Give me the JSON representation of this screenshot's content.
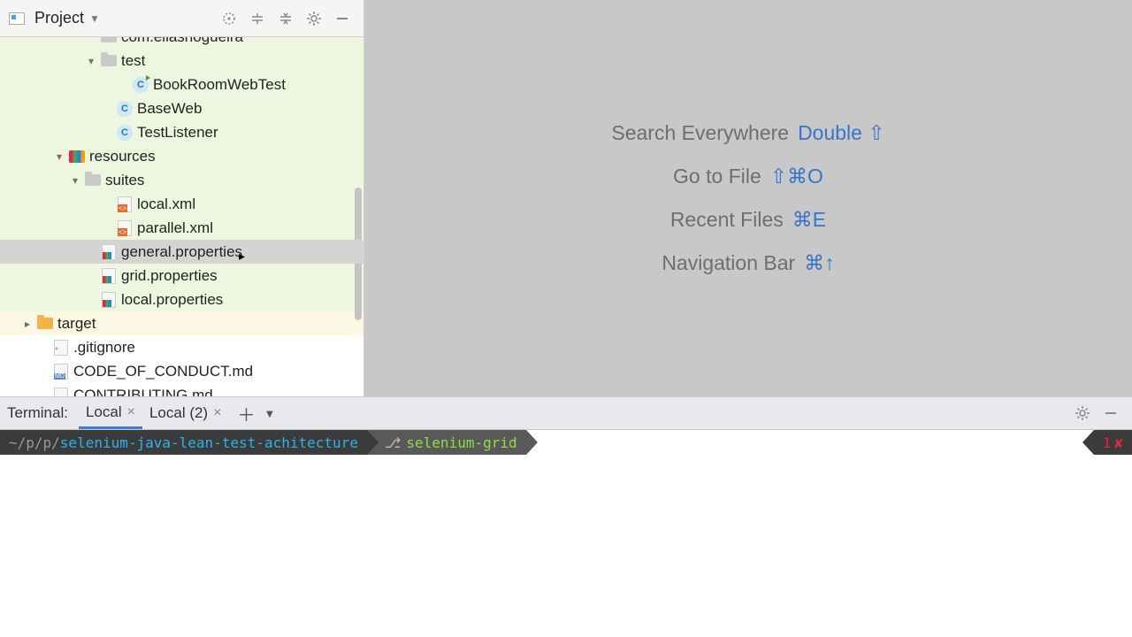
{
  "header": {
    "title": "Project"
  },
  "tree": {
    "items": [
      {
        "indent": 5,
        "arrow": "",
        "icon": "folder",
        "label": "com.eliasnogueira",
        "row": "hl-green cut"
      },
      {
        "indent": 5,
        "arrow": "down",
        "icon": "folder",
        "label": "test",
        "row": "hl-green"
      },
      {
        "indent": 7,
        "arrow": "",
        "icon": "class-run",
        "label": "BookRoomWebTest",
        "row": "hl-green"
      },
      {
        "indent": 6,
        "arrow": "",
        "icon": "class",
        "label": "BaseWeb",
        "row": "hl-green"
      },
      {
        "indent": 6,
        "arrow": "",
        "icon": "class",
        "label": "TestListener",
        "row": "hl-green"
      },
      {
        "indent": 3,
        "arrow": "down",
        "icon": "res",
        "label": "resources",
        "row": "hl-green"
      },
      {
        "indent": 4,
        "arrow": "down",
        "icon": "folder",
        "label": "suites",
        "row": "hl-green"
      },
      {
        "indent": 6,
        "arrow": "",
        "icon": "xml",
        "label": "local.xml",
        "row": "hl-green"
      },
      {
        "indent": 6,
        "arrow": "",
        "icon": "xml",
        "label": "parallel.xml",
        "row": "hl-green"
      },
      {
        "indent": 5,
        "arrow": "",
        "icon": "prop",
        "label": "general.properties",
        "row": "selected"
      },
      {
        "indent": 5,
        "arrow": "",
        "icon": "prop",
        "label": "grid.properties",
        "row": "hl-green"
      },
      {
        "indent": 5,
        "arrow": "",
        "icon": "prop",
        "label": "local.properties",
        "row": "hl-green"
      },
      {
        "indent": 1,
        "arrow": "right",
        "icon": "folder-orange",
        "label": "target",
        "row": "hl-yellow"
      },
      {
        "indent": 2,
        "arrow": "",
        "icon": "git",
        "label": ".gitignore",
        "row": ""
      },
      {
        "indent": 2,
        "arrow": "",
        "icon": "md",
        "label": "CODE_OF_CONDUCT.md",
        "row": ""
      },
      {
        "indent": 2,
        "arrow": "",
        "icon": "md",
        "label": "CONTRIBUTING.md",
        "row": ""
      }
    ]
  },
  "tips": [
    {
      "label": "Search Everywhere",
      "shortcut": "Double ⇧"
    },
    {
      "label": "Go to File",
      "shortcut": "⇧⌘O"
    },
    {
      "label": "Recent Files",
      "shortcut": "⌘E"
    },
    {
      "label": "Navigation Bar",
      "shortcut": "⌘↑"
    }
  ],
  "terminal": {
    "label": "Terminal:",
    "tabs": [
      {
        "name": "Local",
        "active": true
      },
      {
        "name": "Local (2)",
        "active": false
      }
    ],
    "prompt": {
      "path_prefix": "~/p/p/",
      "path_main": "selenium-java-lean-test-achitecture",
      "branch_sep": " ",
      "branch": "selenium-grid",
      "right_num": "1",
      "right_sym": "✘"
    }
  }
}
